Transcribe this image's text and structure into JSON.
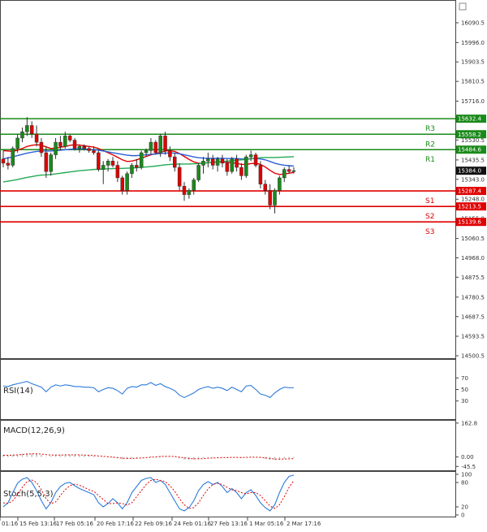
{
  "chart_data": {
    "type": "candlestick",
    "main": {
      "price_axis": {
        "ticks": [
          "16090.5",
          "15996.0",
          "15903.5",
          "15810.5",
          "15716.0",
          "15623.5",
          "15530.5",
          "15435.5",
          "15343.0",
          "15248.0",
          "15155.0",
          "15060.5",
          "14968.0",
          "14875.5",
          "14780.5",
          "14687.5",
          "14593.5",
          "14500.5"
        ],
        "ylim": [
          14500.5,
          16183.0
        ]
      },
      "time_axis": {
        "ticks": [
          "01:16",
          "15 Feb 13:16",
          "17 Feb 05:16",
          "20 Feb 17:16",
          "22 Feb 09:16",
          "24 Feb 01:16",
          "27 Feb 13:16",
          "1 Mar 05:16",
          "2 Mar 17:16"
        ]
      },
      "levels": [
        {
          "name": "R3",
          "value": 15632.4,
          "label": "15632.4",
          "color": "#1a8a1a"
        },
        {
          "name": "R2",
          "value": 15558.2,
          "label": "15558.2",
          "color": "#1a8a1a"
        },
        {
          "name": "R1",
          "value": 15484.6,
          "label": "15484.6",
          "color": "#1a8a1a"
        },
        {
          "name": "S1",
          "value": 15287.4,
          "label": "15287.4",
          "color": "#e00000"
        },
        {
          "name": "S2",
          "value": 15213.5,
          "label": "15213.5",
          "color": "#e00000"
        },
        {
          "name": "S3",
          "value": 15139.6,
          "label": "15139.6",
          "color": "#e00000"
        }
      ],
      "current_price": {
        "value": 15384.0,
        "label": "15384.0"
      },
      "candles_ohlc": [
        [
          15440,
          15480,
          15400,
          15420
        ],
        [
          15420,
          15450,
          15390,
          15410
        ],
        [
          15410,
          15500,
          15400,
          15490
        ],
        [
          15490,
          15560,
          15470,
          15540
        ],
        [
          15540,
          15590,
          15520,
          15570
        ],
        [
          15570,
          15640,
          15550,
          15600
        ],
        [
          15600,
          15620,
          15540,
          15560
        ],
        [
          15560,
          15600,
          15500,
          15520
        ],
        [
          15520,
          15540,
          15450,
          15470
        ],
        [
          15470,
          15500,
          15350,
          15380
        ],
        [
          15380,
          15470,
          15360,
          15460
        ],
        [
          15460,
          15540,
          15440,
          15520
        ],
        [
          15520,
          15550,
          15480,
          15500
        ],
        [
          15500,
          15570,
          15490,
          15550
        ],
        [
          15550,
          15560,
          15520,
          15530
        ],
        [
          15530,
          15540,
          15480,
          15490
        ],
        [
          15490,
          15510,
          15470,
          15500
        ],
        [
          15500,
          15510,
          15480,
          15490
        ],
        [
          15490,
          15500,
          15470,
          15480
        ],
        [
          15480,
          15500,
          15460,
          15470
        ],
        [
          15470,
          15480,
          15380,
          15390
        ],
        [
          15390,
          15430,
          15320,
          15410
        ],
        [
          15410,
          15440,
          15380,
          15430
        ],
        [
          15430,
          15450,
          15400,
          15410
        ],
        [
          15410,
          15430,
          15330,
          15350
        ],
        [
          15350,
          15360,
          15270,
          15290
        ],
        [
          15290,
          15380,
          15270,
          15370
        ],
        [
          15370,
          15420,
          15350,
          15410
        ],
        [
          15410,
          15440,
          15380,
          15400
        ],
        [
          15400,
          15480,
          15390,
          15470
        ],
        [
          15470,
          15490,
          15450,
          15480
        ],
        [
          15480,
          15540,
          15460,
          15520
        ],
        [
          15520,
          15530,
          15460,
          15470
        ],
        [
          15470,
          15560,
          15450,
          15550
        ],
        [
          15550,
          15570,
          15460,
          15480
        ],
        [
          15480,
          15500,
          15430,
          15450
        ],
        [
          15450,
          15470,
          15380,
          15400
        ],
        [
          15400,
          15420,
          15290,
          15310
        ],
        [
          15310,
          15330,
          15240,
          15270
        ],
        [
          15270,
          15300,
          15250,
          15290
        ],
        [
          15290,
          15350,
          15270,
          15340
        ],
        [
          15340,
          15420,
          15330,
          15410
        ],
        [
          15410,
          15450,
          15370,
          15430
        ],
        [
          15430,
          15470,
          15400,
          15440
        ],
        [
          15440,
          15460,
          15390,
          15410
        ],
        [
          15410,
          15450,
          15380,
          15440
        ],
        [
          15440,
          15460,
          15400,
          15420
        ],
        [
          15420,
          15440,
          15360,
          15380
        ],
        [
          15380,
          15450,
          15370,
          15440
        ],
        [
          15440,
          15460,
          15380,
          15400
        ],
        [
          15400,
          15420,
          15340,
          15360
        ],
        [
          15360,
          15460,
          15350,
          15450
        ],
        [
          15450,
          15480,
          15430,
          15460
        ],
        [
          15460,
          15470,
          15400,
          15410
        ],
        [
          15410,
          15430,
          15300,
          15320
        ],
        [
          15320,
          15340,
          15270,
          15290
        ],
        [
          15290,
          15320,
          15200,
          15220
        ],
        [
          15220,
          15300,
          15180,
          15290
        ],
        [
          15290,
          15360,
          15270,
          15350
        ],
        [
          15350,
          15400,
          15330,
          15390
        ],
        [
          15390,
          15410,
          15370,
          15380
        ],
        [
          15380,
          15400,
          15370,
          15384
        ]
      ],
      "moving_averages": [
        {
          "color": "#e00000",
          "values": [
            15480,
            15478,
            15476,
            15482,
            15490,
            15500,
            15505,
            15508,
            15506,
            15498,
            15490,
            15492,
            15496,
            15500,
            15505,
            15508,
            15506,
            15503,
            15500,
            15497,
            15490,
            15480,
            15470,
            15460,
            15448,
            15436,
            15428,
            15430,
            15436,
            15444,
            15452,
            15460,
            15465,
            15472,
            15478,
            15480,
            15476,
            15466,
            15452,
            15438,
            15426,
            15420,
            15420,
            15422,
            15424,
            15426,
            15426,
            15424,
            15422,
            15420,
            15414,
            15414,
            15418,
            15420,
            15414,
            15402,
            15386,
            15372,
            15366,
            15368,
            15372,
            15376
          ]
        },
        {
          "color": "#2c5fd9",
          "values": [
            15440,
            15445,
            15450,
            15456,
            15462,
            15468,
            15472,
            15476,
            15478,
            15478,
            15478,
            15480,
            15482,
            15484,
            15486,
            15488,
            15488,
            15488,
            15486,
            15484,
            15482,
            15478,
            15474,
            15470,
            15466,
            15462,
            15458,
            15456,
            15456,
            15458,
            15460,
            15462,
            15464,
            15466,
            15468,
            15469,
            15468,
            15465,
            15460,
            15455,
            15450,
            15446,
            15444,
            15443,
            15443,
            15443,
            15443,
            15442,
            15442,
            15442,
            15440,
            15440,
            15441,
            15442,
            15440,
            15436,
            15428,
            15420,
            15414,
            15410,
            15408,
            15406
          ]
        },
        {
          "color": "#22aa55",
          "values": [
            15330,
            15334,
            15338,
            15342,
            15347,
            15352,
            15356,
            15360,
            15363,
            15364,
            15366,
            15369,
            15372,
            15375,
            15378,
            15381,
            15384,
            15386,
            15388,
            15390,
            15391,
            15392,
            15393,
            15394,
            15395,
            15395,
            15396,
            15397,
            15398,
            15400,
            15402,
            15404,
            15406,
            15409,
            15412,
            15414,
            15415,
            15416,
            15416,
            15416,
            15417,
            15418,
            15420,
            15422,
            15424,
            15426,
            15428,
            15430,
            15432,
            15434,
            15436,
            15438,
            15441,
            15444,
            15446,
            15447,
            15447,
            15447,
            15448,
            15449,
            15450,
            15451
          ]
        }
      ]
    },
    "rsi": {
      "label": "RSI(14)",
      "ticks": [
        "70",
        "50",
        "30"
      ],
      "ylim": [
        0,
        100
      ],
      "values": [
        56,
        55,
        58,
        60,
        62,
        64,
        60,
        57,
        54,
        46,
        54,
        58,
        56,
        58,
        57,
        55,
        55,
        54,
        54,
        53,
        46,
        50,
        53,
        52,
        48,
        42,
        52,
        55,
        54,
        58,
        58,
        62,
        57,
        60,
        55,
        52,
        48,
        40,
        36,
        40,
        44,
        50,
        53,
        55,
        52,
        54,
        52,
        48,
        54,
        50,
        46,
        56,
        57,
        50,
        42,
        40,
        36,
        44,
        50,
        54,
        53,
        53
      ]
    },
    "macd": {
      "label": "MACD(12,26,9)",
      "ticks": [
        "162.8",
        "0.00",
        "-45.5"
      ],
      "ylim": [
        -60,
        170
      ],
      "histogram": [
        10,
        9,
        10,
        12,
        15,
        18,
        16,
        14,
        10,
        2,
        5,
        9,
        9,
        11,
        11,
        10,
        9,
        8,
        7,
        6,
        1,
        -2,
        -2,
        -3,
        -6,
        -11,
        -9,
        -6,
        -5,
        -1,
        0,
        3,
        2,
        5,
        4,
        2,
        -1,
        -7,
        -12,
        -13,
        -12,
        -8,
        -5,
        -3,
        -3,
        -2,
        -2,
        -3,
        -1,
        -2,
        -4,
        -1,
        1,
        0,
        -4,
        -9,
        -14,
        -15,
        -12,
        -8,
        -6,
        -5
      ],
      "signal": [
        8,
        8,
        9,
        10,
        12,
        14,
        15,
        15,
        14,
        11,
        9,
        9,
        9,
        10,
        10,
        10,
        10,
        9,
        8,
        7,
        5,
        3,
        1,
        -1,
        -3,
        -6,
        -7,
        -7,
        -6,
        -5,
        -3,
        -1,
        0,
        2,
        3,
        3,
        2,
        -1,
        -4,
        -7,
        -9,
        -9,
        -8,
        -6,
        -5,
        -4,
        -3,
        -3,
        -2,
        -2,
        -3,
        -2,
        -1,
        -1,
        -2,
        -4,
        -7,
        -10,
        -11,
        -10,
        -9,
        -8
      ]
    },
    "stoch": {
      "label": "Stoch(5,5,3)",
      "ticks": [
        "100",
        "80",
        "20",
        "0"
      ],
      "ylim": [
        0,
        100
      ],
      "k": [
        20,
        30,
        55,
        78,
        88,
        92,
        80,
        60,
        35,
        15,
        30,
        55,
        70,
        78,
        80,
        72,
        65,
        60,
        55,
        50,
        30,
        20,
        28,
        40,
        30,
        15,
        30,
        55,
        70,
        85,
        90,
        92,
        80,
        85,
        75,
        55,
        35,
        15,
        10,
        18,
        35,
        60,
        75,
        82,
        75,
        80,
        70,
        55,
        65,
        55,
        40,
        55,
        62,
        48,
        30,
        18,
        10,
        25,
        55,
        80,
        95,
        98
      ],
      "d": [
        30,
        28,
        35,
        50,
        68,
        82,
        86,
        80,
        62,
        40,
        28,
        32,
        48,
        62,
        72,
        76,
        73,
        68,
        62,
        58,
        48,
        38,
        28,
        28,
        30,
        28,
        24,
        30,
        45,
        60,
        75,
        85,
        88,
        85,
        82,
        72,
        58,
        40,
        25,
        16,
        18,
        30,
        48,
        64,
        75,
        78,
        75,
        68,
        62,
        60,
        55,
        52,
        55,
        55,
        48,
        35,
        22,
        16,
        25,
        45,
        68,
        85
      ]
    }
  }
}
